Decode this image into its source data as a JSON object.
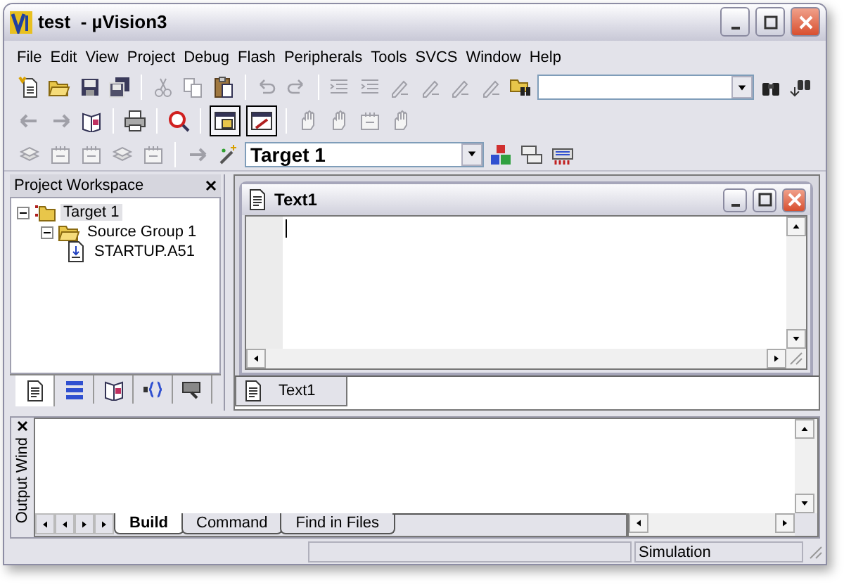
{
  "window": {
    "title": "test  - µVision3"
  },
  "menu": [
    "File",
    "Edit",
    "View",
    "Project",
    "Debug",
    "Flash",
    "Peripherals",
    "Tools",
    "SVCS",
    "Window",
    "Help"
  ],
  "target_combo": {
    "value": "Target 1"
  },
  "workspace": {
    "title": "Project Workspace",
    "tree": [
      {
        "label": "Target 1",
        "kind": "target",
        "selected": true,
        "expanded": true,
        "children": [
          {
            "label": "Source Group 1",
            "kind": "group",
            "selected": false,
            "expanded": true,
            "children": [
              {
                "label": "STARTUP.A51",
                "kind": "file",
                "selected": false
              }
            ]
          }
        ]
      }
    ],
    "tabs": [
      {
        "kind": "files",
        "selected": true
      },
      {
        "kind": "registers",
        "selected": false
      },
      {
        "kind": "books",
        "selected": false
      },
      {
        "kind": "functions",
        "selected": false
      },
      {
        "kind": "templates",
        "selected": false
      }
    ]
  },
  "document": {
    "title": "Text1"
  },
  "document_tabs": [
    {
      "label": "Text1",
      "selected": true
    }
  ],
  "output": {
    "title": "Output Wind",
    "tabs": [
      {
        "label": "Build",
        "selected": true
      },
      {
        "label": "Command",
        "selected": false
      },
      {
        "label": "Find in Files",
        "selected": false
      }
    ]
  },
  "status_bar": [
    "Simulation"
  ]
}
